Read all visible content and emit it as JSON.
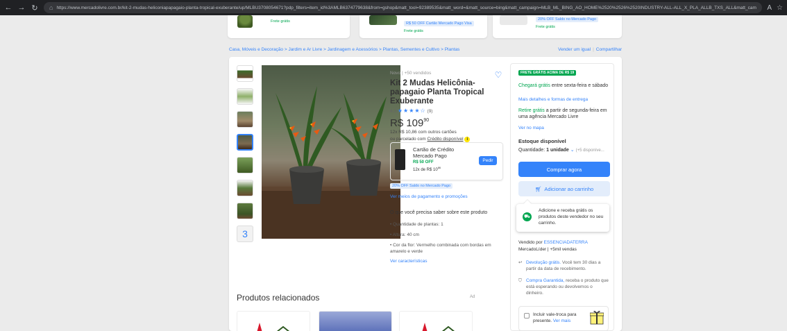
{
  "browser": {
    "url": "https://www.mercadolivre.com.br/kit-2-mudas-heliconiapapagaio-planta-tropical-exuberante/up/MLBU3708054671?pdp_filters=item_id%3AMLB6374779638&from=gshop&matt_tool=92389535&matt_word=&matt_source=bing&matt_campaign=MLB_ML_BING_AO_HOME%2520%2526%2520INDUSTRY-ALL-ALL_X_PLA_ALLB_TXS_ALL&matt_campaig..."
  },
  "top_strip": {
    "frete1": "Frete grátis",
    "tag2": "R$ 50 OFF Cartão Mercado Pago Visa",
    "frete2": "Frete grátis",
    "tag3": "20% OFF Saldo no Mercado Pago",
    "frete3": "Frete grátis"
  },
  "breadcrumb": "Casa, Móveis e Decoração > Jardim e Ar Livre > Jardinagem e Acessórios > Plantas, Sementes e Cultivo > Plantas",
  "breadcrumb_actions": {
    "sell": "Vender um igual",
    "share": "Compartilhar"
  },
  "product": {
    "meta": "Novo | +50 vendidos",
    "title": "Kit 2 Mudas Helicônia-papagaio Planta Tropical Exuberante",
    "rating": "4.2",
    "stars": "★★★★☆",
    "reviews": "(9)",
    "price_main": "R$ 109",
    "price_cents": "90",
    "installments": "12x R$ 10,86 com outros cartões",
    "parcel_prefix": "ou parcelado com",
    "parcel_credit": "Crédito disponível",
    "thumb_more": "3"
  },
  "credit_card": {
    "title": "Cartão de Crédito Mercado Pago",
    "off": "R$ 50 OFF",
    "installment_prefix": "12x de R$ 10",
    "installment_cents": "86",
    "button": "Pedir"
  },
  "promo_tag": "20% OFF Saldo no Mercado Pago",
  "payment_link": "Ver meios de pagamento e promoções",
  "about": {
    "heading": "O que você precisa saber sobre este produto",
    "items": [
      "Quantidade de plantas: 1",
      "Altura: 40 cm",
      "Cor da flor: Vermelho combinada com bordas em amarelo e verde"
    ],
    "link": "Ver características"
  },
  "related": {
    "title": "Produtos relacionados",
    "ad": "Ad"
  },
  "buybox": {
    "badge": "FRETE GRÁTIS ACIMA DE R$ 19",
    "arrive_green": "Chegará grátis",
    "arrive_rest": "entre sexta-feira e sábado",
    "delivery_link": "Mais detalhes e formas de entrega",
    "pickup_green": "Retire grátis",
    "pickup_rest": "a partir de segunda-feira em uma agência Mercado Livre",
    "map_link": "Ver no mapa",
    "stock": "Estoque disponível",
    "qty_label": "Quantidade:",
    "qty_value": "1 unidade",
    "qty_avail": "(+5 disponíve...",
    "buy_now": "Comprar agora",
    "add_cart": "Adicionar ao carrinho",
    "tooltip": "Adicione e receba grátis os produtos deste vendedor no seu carrinho.",
    "seller_prefix": "Vendido por",
    "seller": "ESSENCIADATERRA",
    "seller_meta": "MercadoLíder | +5mil vendas",
    "return_link": "Devolução grátis.",
    "return_rest": "Você tem 30 dias a partir da data de recebimento.",
    "guarantee_link": "Compra Garantida,",
    "guarantee_rest": "receba o produto que está esperando ou devolvemos o dinheiro.",
    "gift": "Incluir vale-troca para presente.",
    "gift_link": "Ver mais"
  },
  "colors": {
    "accent": "#3483fa",
    "green": "#00a650",
    "background": "#ebebeb"
  }
}
